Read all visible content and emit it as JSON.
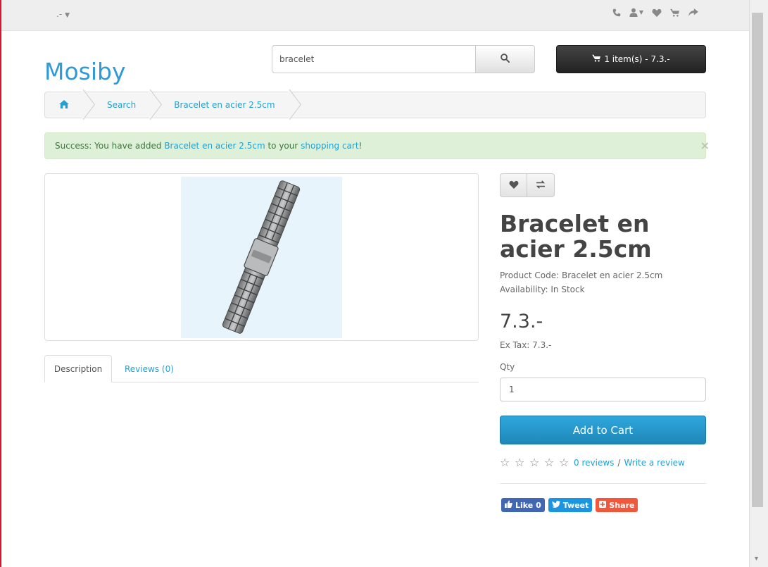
{
  "topbar": {
    "currency_label": ".-",
    "icons": [
      "phone-icon",
      "user-icon",
      "heart-icon",
      "cart-icon",
      "share-icon"
    ]
  },
  "header": {
    "logo": "Mosiby",
    "search_value": "bracelet",
    "cart_label": "1 item(s) - 7.3.-"
  },
  "breadcrumb": {
    "items": [
      "Search",
      "Bracelet en acier 2.5cm"
    ]
  },
  "alert": {
    "prefix": "Success: You have added ",
    "product_link": "Bracelet en acier 2.5cm",
    "middle": " to your ",
    "cart_link": "shopping cart",
    "suffix": "!",
    "close": "×"
  },
  "tabs": {
    "description": "Description",
    "reviews": "Reviews (0)"
  },
  "product": {
    "title": "Bracelet en acier 2.5cm",
    "code_line": "Product Code: Bracelet en acier 2.5cm",
    "availability_line": "Availability: In Stock",
    "price": "7.3.-",
    "ex_tax": "Ex Tax: 7.3.-",
    "qty_label": "Qty",
    "qty_value": "1",
    "add_to_cart": "Add to Cart",
    "rating": 0,
    "reviews_link": "0 reviews",
    "separator": "/",
    "write_review": "Write a review"
  },
  "social": {
    "like": "Like 0",
    "tweet": "Tweet",
    "share": "Share"
  },
  "colors": {
    "accent": "#23a1d1",
    "logo": "#2e9bd6",
    "alert_bg": "#dff0d8",
    "alert_text": "#3c763d",
    "cart_button": "#222222"
  }
}
